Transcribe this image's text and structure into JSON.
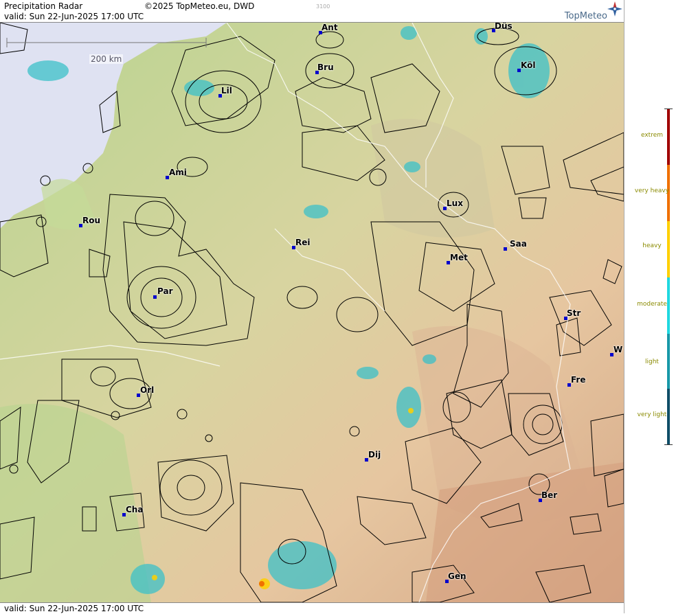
{
  "header": {
    "title": "Precipitation Radar",
    "copyright": "©2025 TopMeteo.eu, DWD",
    "valid": "valid:  Sun  22-Jun-2025 17:00 UTC",
    "mid_code": "3100",
    "logo": "TopMeteo"
  },
  "footer": {
    "valid": "valid:  Sun  22-Jun-2025 17:00 UTC"
  },
  "scale_label": "200 km",
  "cities": [
    {
      "label": "Ant"
    },
    {
      "label": "Düs"
    },
    {
      "label": "Bru"
    },
    {
      "label": "Köl"
    },
    {
      "label": "Lil"
    },
    {
      "label": "Ami"
    },
    {
      "label": "Lux"
    },
    {
      "label": "Rou"
    },
    {
      "label": "Rei"
    },
    {
      "label": "Saa"
    },
    {
      "label": "Met"
    },
    {
      "label": "Par"
    },
    {
      "label": "Str"
    },
    {
      "label": "W"
    },
    {
      "label": "Fre"
    },
    {
      "label": "Orl"
    },
    {
      "label": "Dij"
    },
    {
      "label": "Ber"
    },
    {
      "label": "Cha"
    },
    {
      "label": "Gen"
    }
  ],
  "legend": {
    "levels": [
      {
        "label": "extrem",
        "color": "#a00000"
      },
      {
        "label": "very heavy",
        "color": "#f07000"
      },
      {
        "label": "heavy",
        "color": "#ffd000"
      },
      {
        "label": "moderate",
        "color": "#20d8e0"
      },
      {
        "label": "light",
        "color": "#1898a8"
      },
      {
        "label": "very light",
        "color": "#104e68"
      }
    ]
  },
  "colors": {
    "sea": "#dfe2f2",
    "land_low": "#b8d490",
    "land_high": "#e6c6a0",
    "rain": "#3cc0c8"
  }
}
